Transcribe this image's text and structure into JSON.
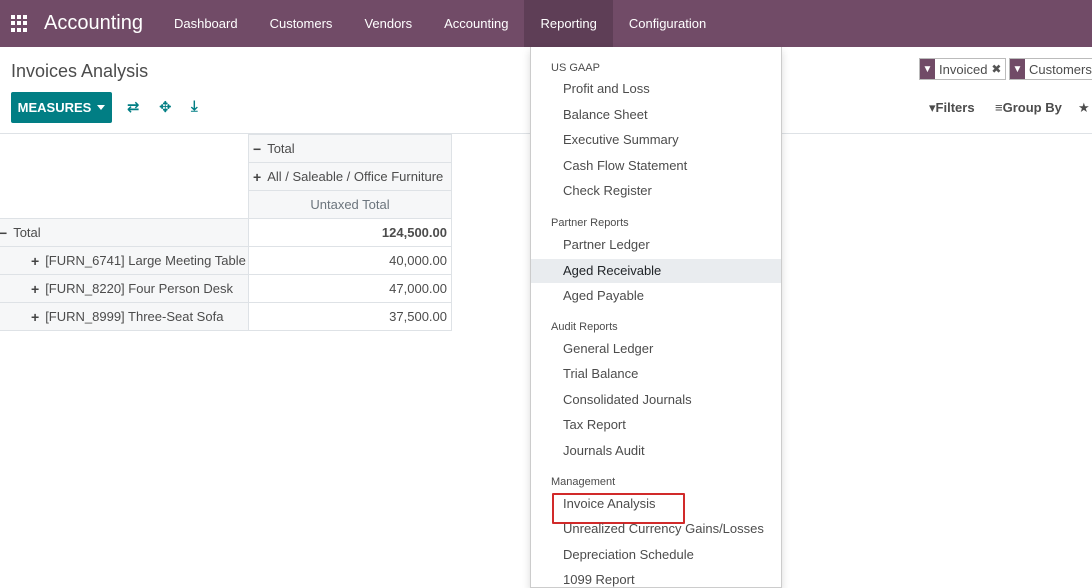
{
  "navbar": {
    "brand": "Accounting",
    "menu": [
      "Dashboard",
      "Customers",
      "Vendors",
      "Accounting",
      "Reporting",
      "Configuration"
    ],
    "active": "Reporting"
  },
  "page": {
    "title": "Invoices Analysis",
    "measures_label": "MEASURES"
  },
  "search": {
    "facets": [
      {
        "label": "Invoiced"
      },
      {
        "label": "Customers"
      }
    ],
    "filters_label": "Filters",
    "groupby_label": "Group By"
  },
  "pivot": {
    "col_total": "Total",
    "col_group": "All / Saleable / Office Furniture",
    "measure": "Untaxed Total",
    "row_total_label": "Total",
    "row_total_value": "124,500.00",
    "rows": [
      {
        "label": "[FURN_6741] Large Meeting Table",
        "value": "40,000.00"
      },
      {
        "label": "[FURN_8220] Four Person Desk",
        "value": "47,000.00"
      },
      {
        "label": "[FURN_8999] Three-Seat Sofa",
        "value": "37,500.00"
      }
    ]
  },
  "reporting_menu": {
    "us_gaap": {
      "header": "US GAAP",
      "items": [
        "Profit and Loss",
        "Balance Sheet",
        "Executive Summary",
        "Cash Flow Statement",
        "Check Register"
      ]
    },
    "partner": {
      "header": "Partner Reports",
      "items": [
        "Partner Ledger",
        "Aged Receivable",
        "Aged Payable"
      ]
    },
    "audit": {
      "header": "Audit Reports",
      "items": [
        "General Ledger",
        "Trial Balance",
        "Consolidated Journals",
        "Tax Report",
        "Journals Audit"
      ]
    },
    "management": {
      "header": "Management",
      "items": [
        "Invoice Analysis",
        "Unrealized Currency Gains/Losses",
        "Depreciation Schedule",
        "1099 Report"
      ]
    }
  }
}
